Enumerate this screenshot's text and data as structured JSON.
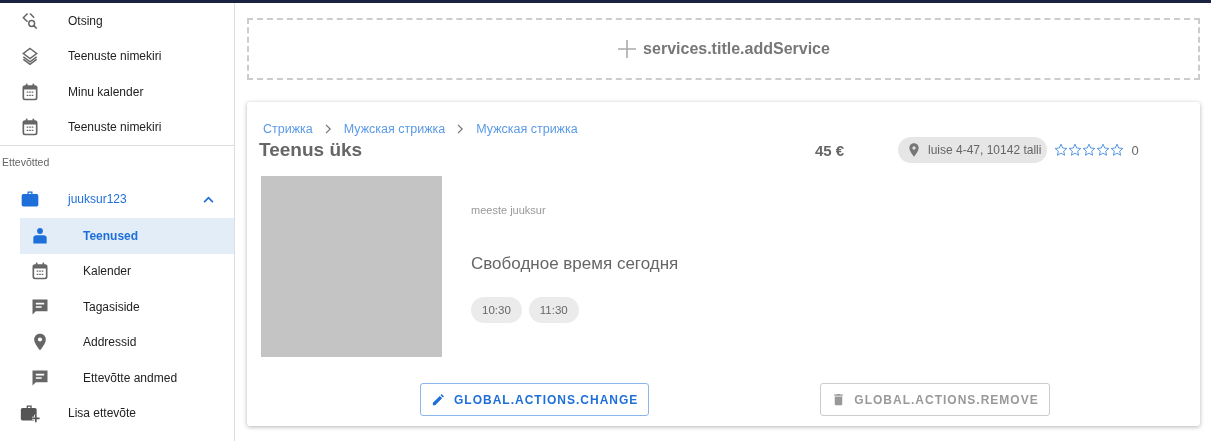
{
  "sidebar": {
    "items": [
      {
        "label": "Otsing",
        "selected": false
      },
      {
        "label": "Teenuste nimekiri",
        "selected": false
      },
      {
        "label": "Minu kalender",
        "selected": false
      },
      {
        "label": "Teenuste nimekiri",
        "selected": false
      }
    ],
    "section_label": "Ettevõtted",
    "company": {
      "label": "juuksur123",
      "expanded": true,
      "children": [
        {
          "label": "Teenused",
          "selected": true
        },
        {
          "label": "Kalender",
          "selected": false
        },
        {
          "label": "Tagasiside",
          "selected": false
        },
        {
          "label": "Addressid",
          "selected": false
        },
        {
          "label": "Ettevõtte andmed",
          "selected": false
        }
      ]
    },
    "add_company": {
      "label": "Lisa ettevõte"
    }
  },
  "add_service": {
    "label": "services.title.addService"
  },
  "service_card": {
    "breadcrumbs": [
      "Стрижка",
      "Мужская стрижка",
      "Мужская стрижка"
    ],
    "title": "Teenus üks",
    "price": "45 €",
    "address": "luise 4-47, 10142 talli",
    "stars": 0,
    "rating": "0",
    "category": "meeste juuksur",
    "free_time_heading": "Свободное время сегодня",
    "times": [
      "10:30",
      "11:30"
    ],
    "actions": [
      {
        "label": "GLOBAL.ACTIONS.CHANGE",
        "disabled": false
      },
      {
        "label": "GLOBAL.ACTIONS.REMOVE",
        "disabled": true
      }
    ]
  }
}
